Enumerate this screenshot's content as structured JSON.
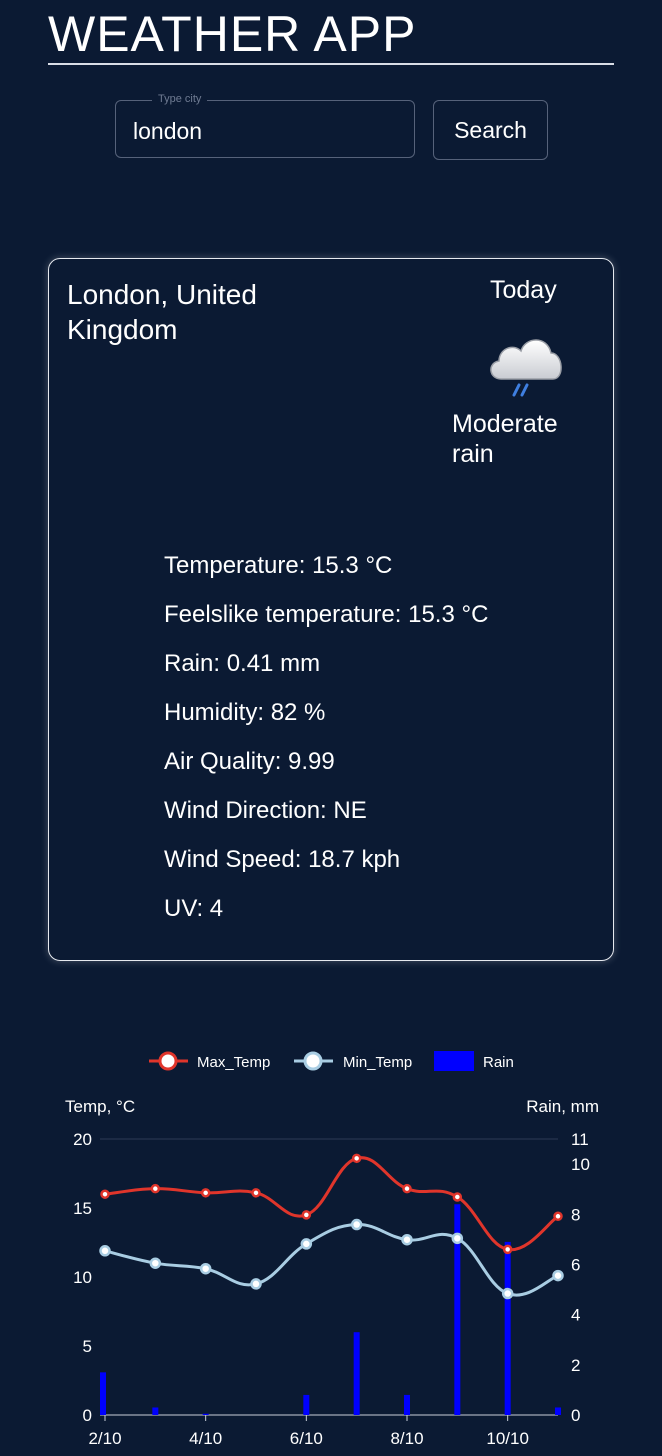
{
  "app": {
    "title": "WEATHER APP"
  },
  "search": {
    "label": "Type city",
    "value": "london",
    "button_label": "Search"
  },
  "current": {
    "location": "London, United Kingdom",
    "day_label": "Today",
    "condition": "Moderate rain",
    "condition_icon": "cloud-rain-icon",
    "stats": [
      "Temperature: 15.3 °C",
      "Feelslike temperature: 15.3 °C",
      "Rain: 0.41 mm",
      "Humidity: 82 %",
      "Air Quality: 9.99",
      "Wind Direction: NE",
      "Wind Speed: 18.7 kph",
      "UV: 4"
    ]
  },
  "colors": {
    "background": "#0b1a33",
    "max_temp": "#e0352b",
    "min_temp": "#a9cde3",
    "rain": "#0000ff"
  },
  "chart_data": {
    "type": "line",
    "legend_position": "top-center",
    "x_ticks": [
      "2/10",
      "4/10",
      "6/10",
      "8/10",
      "10/10"
    ],
    "x": [
      "2/10",
      "3/10",
      "4/10",
      "5/10",
      "6/10",
      "7/10",
      "8/10",
      "9/10",
      "10/10",
      "11/10"
    ],
    "left_axis": {
      "label": "Temp, °C",
      "range": [
        0,
        20
      ],
      "ticks": [
        "0",
        "5",
        "10",
        "15",
        "20"
      ]
    },
    "right_axis": {
      "label": "Rain, mm",
      "range": [
        0,
        11
      ],
      "ticks": [
        "0",
        "2",
        "4",
        "6",
        "8",
        "10",
        "11"
      ]
    },
    "series": [
      {
        "name": "Max_Temp",
        "type": "line",
        "axis": "left",
        "values": [
          16.0,
          16.4,
          16.1,
          16.1,
          14.5,
          18.6,
          16.4,
          15.8,
          12.0,
          14.4
        ]
      },
      {
        "name": "Min_Temp",
        "type": "line",
        "axis": "left",
        "values": [
          11.9,
          11.0,
          10.6,
          9.5,
          12.4,
          13.8,
          12.7,
          12.8,
          8.8,
          10.1
        ]
      },
      {
        "name": "Rain",
        "type": "bar",
        "axis": "right",
        "values": [
          1.7,
          0.3,
          0.05,
          0,
          0.8,
          3.3,
          0.8,
          8.4,
          6.9,
          0.3
        ]
      }
    ]
  }
}
